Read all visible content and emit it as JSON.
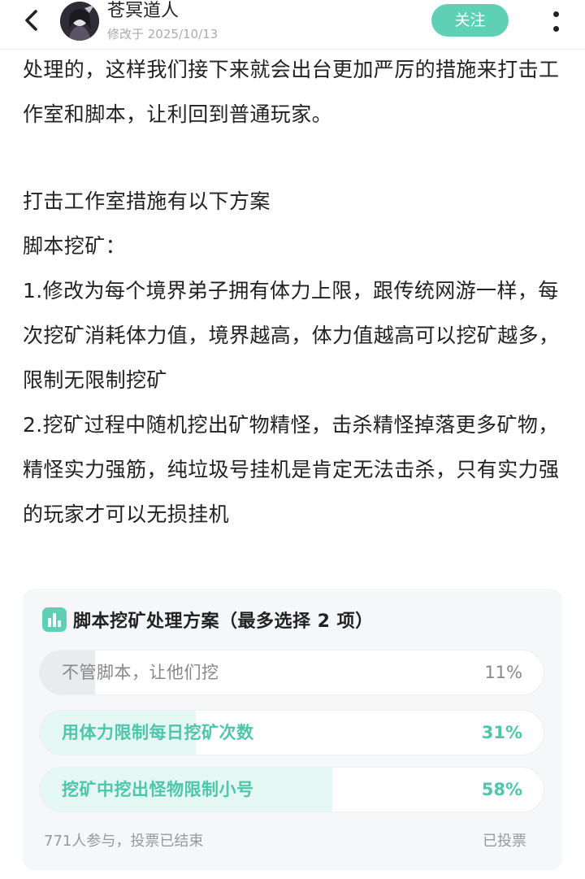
{
  "header": {
    "author_name": "苍冥道人",
    "modified_time": "修改于 2025/10/13",
    "follow_label": "关注",
    "back_icon": "chevron-left-icon",
    "more_icon": "more-vertical-icon"
  },
  "article": {
    "paragraphs": [
      "处理的，这样我们接下来就会出台更加严厉的措施来打击工作室和脚本，让利回到普通玩家。",
      "打击工作室措施有以下方案",
      "脚本挖矿：",
      "1.修改为每个境界弟子拥有体力上限，跟传统网游一样，每次挖矿消耗体力值，境界越高，体力值越高可以挖矿越多，限制无限制挖矿",
      "2.挖矿过程中随机挖出矿物精怪，击杀精怪掉落更多矿物，精怪实力强筋，纯垃圾号挂机是肯定无法击杀，只有实力强的玩家才可以无损挂机"
    ]
  },
  "poll": {
    "icon": "bar-chart-icon",
    "title": "脚本挖矿处理方案（最多选择 2 项）",
    "options": [
      {
        "label": "不管脚本，让他们挖",
        "percent_text": "11%",
        "percent": 11,
        "voted": false
      },
      {
        "label": "用体力限制每日挖矿次数",
        "percent_text": "31%",
        "percent": 31,
        "voted": true
      },
      {
        "label": "挖矿中挖出怪物限制小号",
        "percent_text": "58%",
        "percent": 58,
        "voted": true
      }
    ],
    "participants": "771人参与，投票已结束",
    "status": "已投票"
  },
  "colors": {
    "accent": "#5fd0b6",
    "voted_text": "#4fc6ab",
    "voted_fill": "#e4f7f3",
    "unvoted_fill": "#e9ebef"
  }
}
